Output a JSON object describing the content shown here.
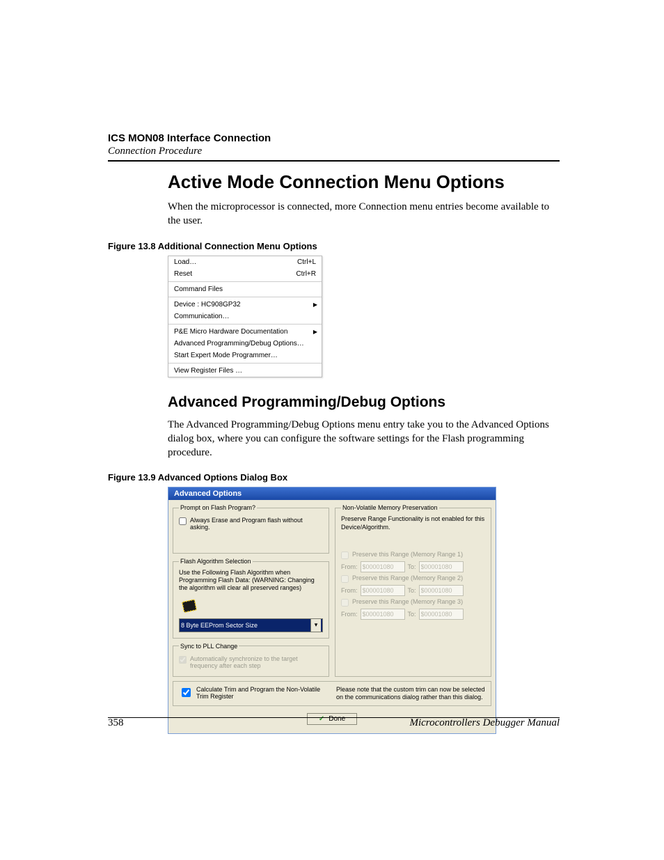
{
  "header": {
    "title": "ICS MON08 Interface Connection",
    "subtitle": "Connection Procedure"
  },
  "section1": {
    "heading": "Active Mode Connection Menu Options",
    "para": "When the microprocessor is connected, more Connection menu entries become available to the user."
  },
  "fig8": {
    "caption": "Figure 13.8  Additional Connection Menu Options",
    "menu": {
      "load": "Load…",
      "load_sc": "Ctrl+L",
      "reset": "Reset",
      "reset_sc": "Ctrl+R",
      "cmd": "Command Files",
      "device": "Device : HC908GP32",
      "comm": "Communication…",
      "pe": "P&E Micro Hardware Documentation",
      "adv": "Advanced Programming/Debug Options…",
      "expert": "Start Expert Mode Programmer…",
      "regs": "View Register Files …"
    }
  },
  "section2": {
    "heading": "Advanced Programming/Debug Options",
    "para": "The Advanced Programming/Debug Options menu entry take you to the Advanced Options dialog box, where you can configure the software settings for the Flash programming procedure."
  },
  "fig9": {
    "caption": "Figure 13.9  Advanced Options Dialog Box",
    "dialog": {
      "title": "Advanced Options",
      "prompt": {
        "legend": "Prompt on Flash Program?",
        "cb": "Always Erase and Program flash without asking."
      },
      "nv": {
        "legend": "Non-Volatile Memory Preservation",
        "note": "Preserve Range Functionality is not enabled for this Device/Algorithm.",
        "r1": "Preserve this Range (Memory Range 1)",
        "r2": "Preserve this Range (Memory Range 2)",
        "r3": "Preserve this Range (Memory Range 3)",
        "from": "From:",
        "to": "To:",
        "addr": "$00001080"
      },
      "algo": {
        "legend": "Flash Algorithm Selection",
        "warn": "Use the Following Flash Algorithm when Programming Flash Data: (WARNING: Changing the algorithm will clear all preserved ranges)",
        "selected": "8 Byte EEProm Sector Size"
      },
      "sync": {
        "legend": "Sync to PLL Change",
        "cb": "Automatically synchronize to the target frequency after each step"
      },
      "trim": {
        "cb": "Calculate Trim and Program the Non-Volatile Trim Register",
        "note": "Please note that the custom trim can now be selected on the communications dialog rather than this dialog."
      },
      "done": "Done"
    }
  },
  "footer": {
    "page": "358",
    "manual": "Microcontrollers Debugger Manual"
  }
}
